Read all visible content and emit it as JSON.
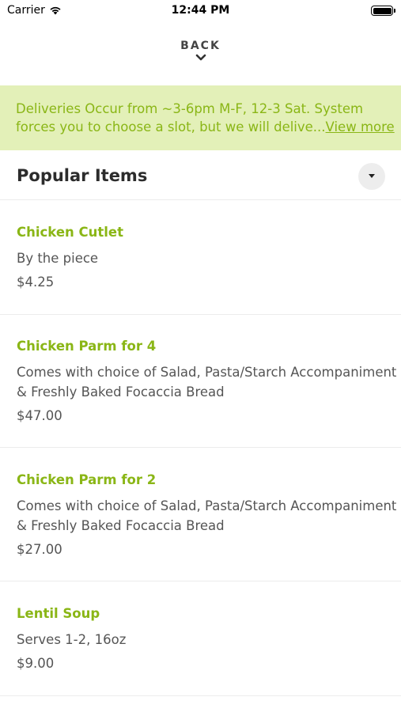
{
  "status_bar": {
    "carrier": "Carrier",
    "time": "12:44 PM"
  },
  "nav": {
    "back_label": "BACK"
  },
  "banner": {
    "line1": "Deliveries Occur from ~3-6pm M-F, 12-3 Sat. System",
    "line2": "forces you to choose a slot, but we will delive...",
    "view_more": "View more",
    "color": "#8ab616",
    "background": "#e3f0b8"
  },
  "section": {
    "title": "Popular Items"
  },
  "items": [
    {
      "name": "Chicken Cutlet",
      "description": [
        "By the piece"
      ],
      "price": "$4.25"
    },
    {
      "name": "Chicken Parm for 4",
      "description": [
        "Comes with choice of Salad, Pasta/Starch Accompaniment",
        "& Freshly Baked Focaccia Bread"
      ],
      "price": "$47.00"
    },
    {
      "name": "Chicken Parm for 2",
      "description": [
        "Comes with choice of Salad, Pasta/Starch Accompaniment",
        "& Freshly Baked Focaccia Bread"
      ],
      "price": "$27.00"
    },
    {
      "name": "Lentil Soup",
      "description": [
        "Serves 1-2, 16oz"
      ],
      "price": "$9.00"
    }
  ],
  "icons": {
    "wifi": "wifi-icon",
    "battery": "battery-icon",
    "back": "chevron-down-icon",
    "collapse": "caret-down-icon"
  }
}
